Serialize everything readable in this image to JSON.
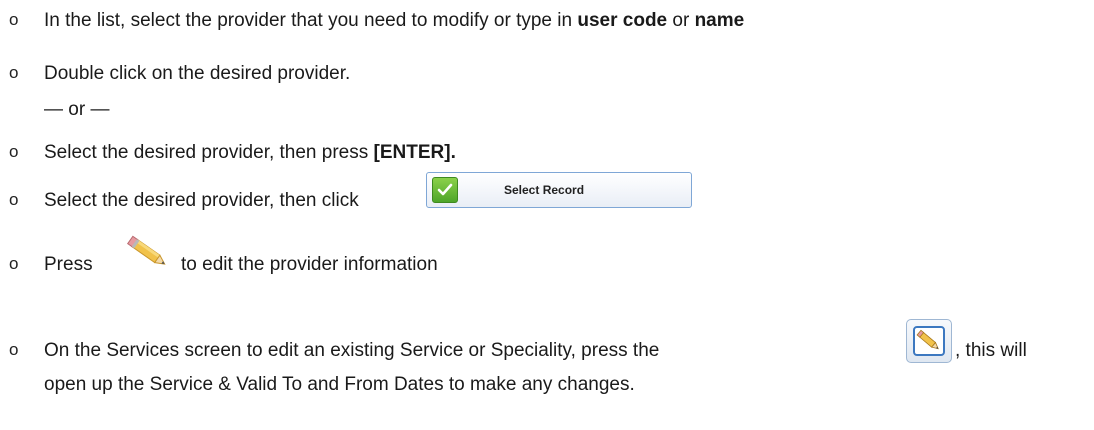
{
  "bullet_symbol": "o",
  "steps": [
    {
      "before": "In the list, select the provider that you need to modify or type in ",
      "bold1": "user code",
      "middle": " or ",
      "bold2": "name"
    },
    {
      "text": "Double click on the desired provider."
    },
    {
      "text": "— or —"
    },
    {
      "before": "Select the desired provider, then press ",
      "bold": "[ENTER]."
    },
    {
      "text": "Select the desired provider, then click"
    },
    {
      "before": "Press",
      "after": "to edit the provider information"
    },
    {
      "line1_before": "On the Services screen to edit an existing Service or Speciality, press the",
      "line1_after": ", this will",
      "line2": "open up the Service & Valid To and From Dates to make any changes."
    }
  ],
  "select_record_button": {
    "label": "Select Record",
    "icon": "checkmark-icon",
    "accent": "#5bb435"
  },
  "edit_icon": {
    "icon": "pencil-icon"
  },
  "edit_button": {
    "icon": "pencil-icon",
    "border_color": "#3c78c0"
  }
}
